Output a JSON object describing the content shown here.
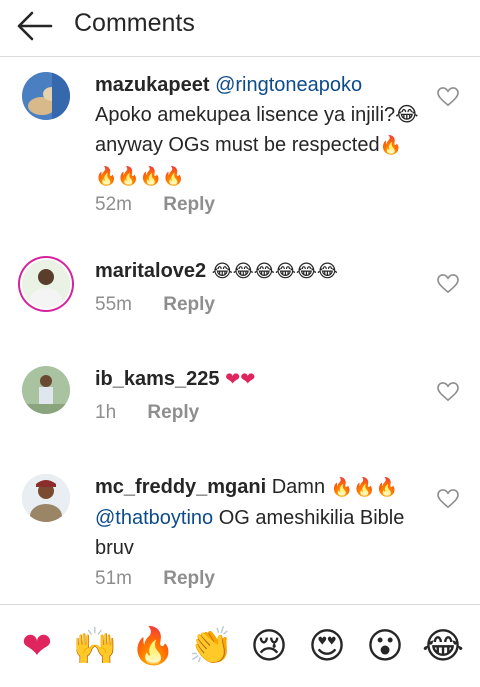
{
  "header": {
    "title": "Comments",
    "back_icon": "arrow-left-icon"
  },
  "comments": [
    {
      "username": "mazukapeet",
      "mention": "@ringtoneapoko",
      "text": "Apoko amekupea lisence ya injili?😂anyway OGs must be respected",
      "emoji_tail": "🔥🔥🔥🔥🔥",
      "time": "52m",
      "reply": "Reply"
    },
    {
      "username": "maritalove2",
      "emoji_tail": "😂😂😂😂😂😂",
      "time": "55m",
      "reply": "Reply"
    },
    {
      "username": "ib_kams_225",
      "emoji_tail": "❤❤",
      "time": "1h",
      "reply": "Reply"
    },
    {
      "username": "mc_freddy_mgani",
      "text_before": "Damn",
      "emoji_inline": "🔥🔥🔥",
      "mention": "@thatboytino",
      "text_after": "OG ameshikilia Bible bruv",
      "time": "51m",
      "reply": "Reply"
    }
  ],
  "reactions": [
    "❤",
    "🙌",
    "🔥",
    "👏",
    "😢",
    "😍",
    "😮",
    "😂"
  ],
  "colors": {
    "mention": "#0d4b8b",
    "meta": "#8e8e8e",
    "text": "#262626",
    "divider": "#dbdbdb"
  }
}
